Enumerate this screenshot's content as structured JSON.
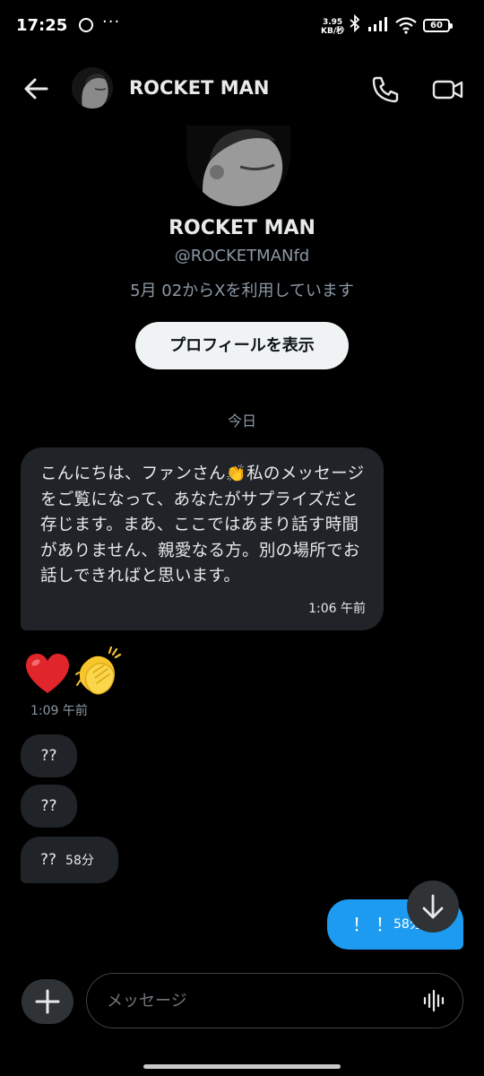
{
  "status_bar": {
    "time": "17:25",
    "more": "···",
    "net_speed_value": "3.95",
    "net_speed_unit": "KB/秒",
    "battery": "60"
  },
  "header": {
    "name": "ROCKET MAN"
  },
  "profile": {
    "name": "ROCKET MAN",
    "handle": "@ROCKETMANfd",
    "joined": "5月 02からXを利用しています",
    "view_profile_label": "プロフィールを表示"
  },
  "date_divider": "今日",
  "messages": [
    {
      "direction": "incoming",
      "text": "こんにちは、ファンさん👏私のメッセージをご覧になって、あなたがサプライズだと存じます。まあ、ここではあまり話す時間がありません、親愛なる方。別の場所でお話しできればと思います。",
      "time": "1:06 午前"
    },
    {
      "direction": "incoming",
      "emoji": [
        "heart",
        "clapping-hands"
      ],
      "time": "1:09 午前"
    },
    {
      "direction": "incoming",
      "text": "??"
    },
    {
      "direction": "incoming",
      "text": "??"
    },
    {
      "direction": "incoming",
      "text": "??",
      "time": "58分"
    },
    {
      "direction": "outgoing",
      "text": "！！",
      "time": "58分"
    }
  ],
  "composer": {
    "placeholder": "メッセージ"
  },
  "colors": {
    "background": "#000000",
    "incoming_bubble": "#202327",
    "outgoing_bubble": "#1d9bf0",
    "secondary_text": "#8b98a5"
  }
}
